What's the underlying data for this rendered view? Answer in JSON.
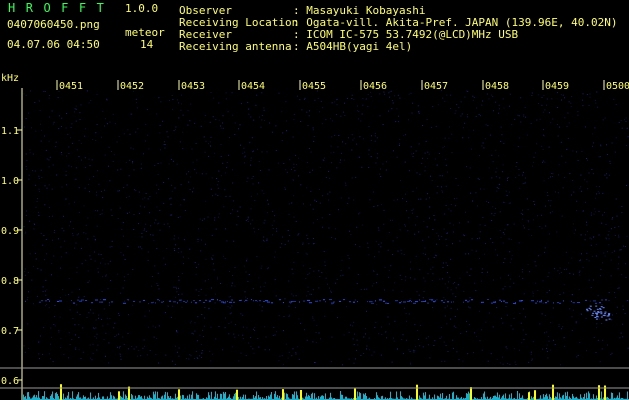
{
  "header": {
    "brand": "HROFFT",
    "version": "1.0.0",
    "filename": "0407060450.png",
    "datetime": "04.07.06 04:50",
    "meteor_label": "meteor",
    "meteor_count": "14",
    "observer_label": "Observer",
    "observer_value": ": Masayuki Kobayashi",
    "location_label": "Receiving Location",
    "location_value": ": Ogata-vill. Akita-Pref. JAPAN (139.96E, 40.02N)",
    "receiver_label": "Receiver",
    "receiver_value": ": ICOM IC-575 53.7492(@LCD)MHz USB",
    "antenna_label": "Receiving antenna",
    "antenna_value": ": A504HB(yagi 4el)"
  },
  "spectrogram": {
    "unit": "kHz",
    "time_ticks": [
      "0451",
      "0452",
      "0453",
      "0454",
      "0455",
      "0456",
      "0457",
      "0458",
      "0459",
      "0500"
    ],
    "freq_ticks": [
      "1.1",
      "1.0",
      "0.9",
      "0.8",
      "0.7",
      "0.6"
    ],
    "freq_values": [
      1.1,
      1.0,
      0.9,
      0.8,
      0.7,
      0.6
    ],
    "colors": {
      "background": "#000000",
      "noise": "#1c2a8a",
      "text": "#ffff66",
      "brand": "#33ff55",
      "trace": "#3355ff",
      "intensity_low": "#22ddff",
      "intensity_high": "#ffff00"
    }
  }
}
